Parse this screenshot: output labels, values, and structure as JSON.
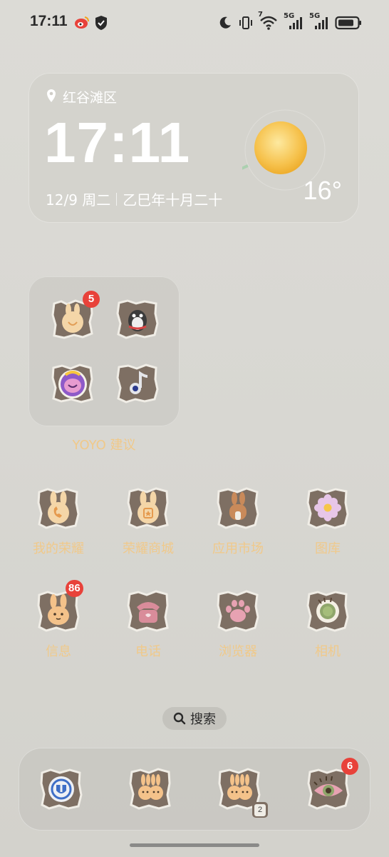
{
  "status_bar": {
    "time": "17:11",
    "icons": [
      "weibo-icon",
      "shield-icon",
      "moon-icon",
      "vibrate-icon",
      "wifi-icon",
      "signal-5g-icon",
      "signal-5g-icon",
      "battery-icon"
    ],
    "wifi_badge": "7",
    "net1": "5G",
    "net2": "5G"
  },
  "weather": {
    "location": "红谷滩区",
    "time": "17:11",
    "date": "12/9 周二",
    "lunar": "乙巳年十月二十",
    "temperature": "16°",
    "condition_icon": "sun-icon"
  },
  "folder": {
    "label": "YOYO 建议",
    "apps": [
      {
        "icon": "honor-bunny-icon",
        "badge": "5"
      },
      {
        "icon": "qq-penguin-icon",
        "badge": ""
      },
      {
        "icon": "game-character-icon",
        "badge": ""
      },
      {
        "icon": "music-note-icon",
        "badge": ""
      }
    ]
  },
  "apps": [
    {
      "label": "我的荣耀",
      "icon": "bunny-phone-icon",
      "badge": ""
    },
    {
      "label": "荣耀商城",
      "icon": "bunny-shop-icon",
      "badge": ""
    },
    {
      "label": "应用市场",
      "icon": "bunny-house-icon",
      "badge": ""
    },
    {
      "label": "图库",
      "icon": "flower-icon",
      "badge": ""
    },
    {
      "label": "信息",
      "icon": "bunny-message-icon",
      "badge": "86"
    },
    {
      "label": "电话",
      "icon": "telephone-icon",
      "badge": ""
    },
    {
      "label": "浏览器",
      "icon": "paw-icon",
      "badge": ""
    },
    {
      "label": "相机",
      "icon": "camera-icon",
      "badge": ""
    }
  ],
  "search": {
    "label": "搜索"
  },
  "dock": [
    {
      "icon": "security-shield-icon",
      "badge": ""
    },
    {
      "icon": "twin-bunnies-icon",
      "badge": ""
    },
    {
      "icon": "twin-bunnies-clone-icon",
      "badge": "2"
    },
    {
      "icon": "eye-icon",
      "badge": "6"
    }
  ],
  "colors": {
    "label": "#f0c98a",
    "badge": "#e8423a",
    "paper": "#7e6f63"
  }
}
